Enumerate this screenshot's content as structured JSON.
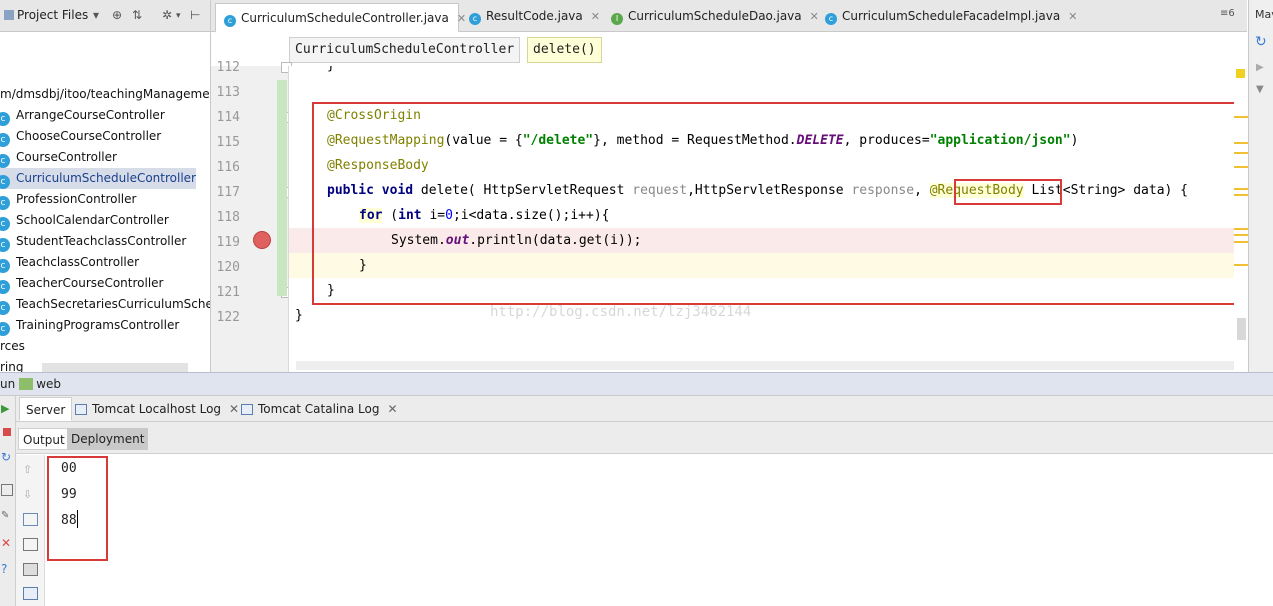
{
  "project_panel": {
    "title": "Project Files",
    "path_row": "m/dmsdbj/itoo/teachingManageme",
    "items": [
      {
        "label": "ArrangeCourseController"
      },
      {
        "label": "ChooseCourseController"
      },
      {
        "label": "CourseController"
      },
      {
        "label": "CurriculumScheduleController",
        "selected": true
      },
      {
        "label": "ProfessionController"
      },
      {
        "label": "SchoolCalendarController"
      },
      {
        "label": "StudentTeachclassController"
      },
      {
        "label": "TeachclassController"
      },
      {
        "label": "TeacherCourseController"
      },
      {
        "label": "TeachSecretariesCurriculumSche"
      },
      {
        "label": "TrainingProgramsController"
      }
    ],
    "trailing_rows": [
      "rces",
      "ring"
    ]
  },
  "editor_tabs": [
    {
      "label": "CurriculumScheduleController.java",
      "icon": "class-icon",
      "active": true
    },
    {
      "label": "ResultCode.java",
      "icon": "class-icon"
    },
    {
      "label": "CurriculumScheduleDao.java",
      "icon": "interface-icon"
    },
    {
      "label": "CurriculumScheduleFacadeImpl.java",
      "icon": "class-icon"
    }
  ],
  "tab_overflow": "≡6",
  "right_strip_label": "Mav",
  "breadcrumbs": [
    "CurriculumScheduleController",
    "delete()"
  ],
  "line_numbers": [
    "112",
    "113",
    "114",
    "115",
    "116",
    "117",
    "118",
    "119",
    "120",
    "121",
    "122"
  ],
  "code": {
    "l112": "}",
    "l114": "@CrossOrigin",
    "l115_ann": "@RequestMapping",
    "l115_a": "(value = {",
    "l115_s1": "\"/delete\"",
    "l115_b": "}, method = RequestMethod.",
    "l115_const": "DELETE",
    "l115_c": ", produces=",
    "l115_s2": "\"application/json\"",
    "l115_d": ")",
    "l116": "@ResponseBody",
    "l117_kw1": "public",
    "l117_kw2": "void",
    "l117_a": " delete( HttpServletRequest ",
    "l117_p1": "request",
    "l117_b": ",HttpServletResponse ",
    "l117_p2": "response",
    "l117_c": ", ",
    "l117_ann": "@RequestBody",
    "l117_d": " List<String> data) {",
    "l118_kw1": "for",
    "l118_a": " (",
    "l118_kw2": "int",
    "l118_b": " i=",
    "l118_n": "0",
    "l118_c": ";i<data.size();i++){",
    "l119_a": "System.",
    "l119_out": "out",
    "l119_b": ".println(data.get(i));",
    "l120": "}",
    "l121": "}",
    "l122": "}"
  },
  "watermark": "http://blog.csdn.net/lzj3462144",
  "run_panel": {
    "title_prefix": "un",
    "config_name": "web",
    "tabs": [
      {
        "label": "Server",
        "active": true
      },
      {
        "label": "Tomcat Localhost Log"
      },
      {
        "label": "Tomcat Catalina Log"
      }
    ],
    "sub_tabs": [
      {
        "label": "Output",
        "active": true
      },
      {
        "label": "Deployment"
      }
    ],
    "output_lines": [
      "00",
      "99",
      "88"
    ]
  },
  "colors": {
    "highlight_red": "#d83a3a",
    "annotation": "#808000",
    "keyword": "#000080",
    "string": "#008000",
    "breakpoint": "#e06060"
  }
}
